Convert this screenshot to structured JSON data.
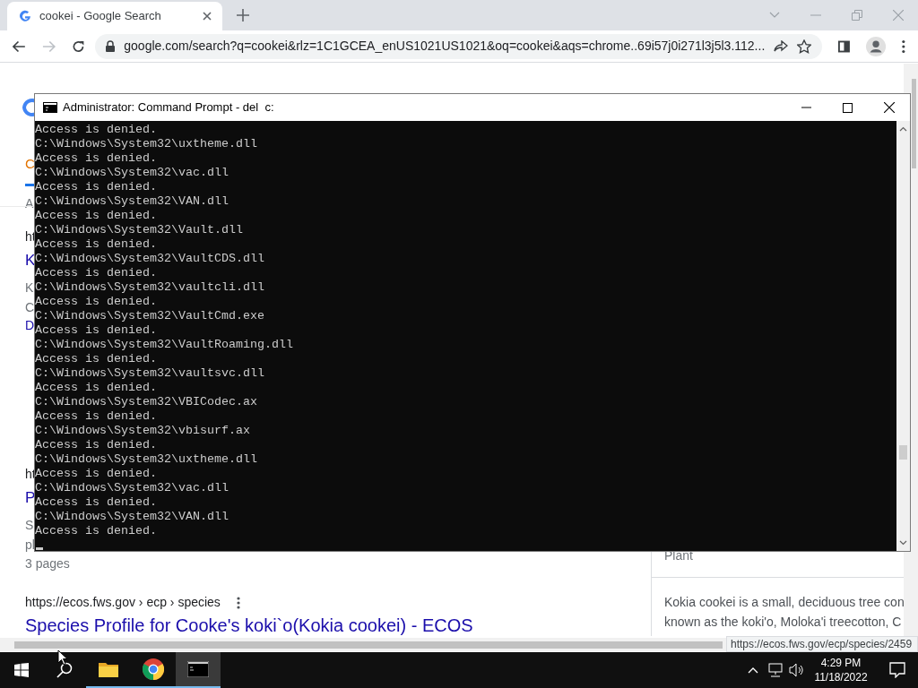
{
  "browser": {
    "tab": {
      "title": "cookei - Google Search",
      "selected": true
    },
    "url": "google.com/search?q=cookei&rlz=1C1GCEA_enUS1021US1021&oq=cookei&aqs=chrome..69i57j0i271l3j5l3.112...",
    "page": {
      "fragments": [
        {
          "kind": "tab",
          "text": "C"
        },
        {
          "kind": "meta",
          "text": "A"
        },
        {
          "kind": "url",
          "text": "ht"
        },
        {
          "kind": "title",
          "text": "K"
        },
        {
          "kind": "meta",
          "text": "K"
        },
        {
          "kind": "meta",
          "text": "C"
        },
        {
          "kind": "link",
          "text": "D"
        },
        {
          "kind": "url",
          "text": "ht"
        },
        {
          "kind": "title",
          "text": "P"
        },
        {
          "kind": "meta",
          "text": "S"
        },
        {
          "kind": "meta",
          "text": "pl"
        },
        {
          "kind": "meta",
          "text": "3 pages"
        }
      ],
      "result": {
        "breadcrumb": "https://ecos.fws.gov › ecp › species",
        "title": "Species Profile for Cooke's koki`o(Kokia cookei) - ECOS"
      },
      "panel": {
        "label": "Plant",
        "description": [
          "Kokia cookei is a small, deciduous tree con",
          "known as the koki'o, Moloka'i treecotton, C"
        ]
      },
      "status_url": "https://ecos.fws.gov/ecp/species/2459"
    }
  },
  "console": {
    "title": "Administrator: Command Prompt - del  c:",
    "lines": [
      "Access is denied.",
      "C:\\Windows\\System32\\uxtheme.dll",
      "Access is denied.",
      "C:\\Windows\\System32\\vac.dll",
      "Access is denied.",
      "C:\\Windows\\System32\\VAN.dll",
      "Access is denied.",
      "C:\\Windows\\System32\\Vault.dll",
      "Access is denied.",
      "C:\\Windows\\System32\\VaultCDS.dll",
      "Access is denied.",
      "C:\\Windows\\System32\\vaultcli.dll",
      "Access is denied.",
      "C:\\Windows\\System32\\VaultCmd.exe",
      "Access is denied.",
      "C:\\Windows\\System32\\VaultRoaming.dll",
      "Access is denied.",
      "C:\\Windows\\System32\\vaultsvc.dll",
      "Access is denied.",
      "C:\\Windows\\System32\\VBICodec.ax",
      "Access is denied.",
      "C:\\Windows\\System32\\vbisurf.ax",
      "Access is denied.",
      "C:\\Windows\\System32\\uxtheme.dll",
      "Access is denied.",
      "C:\\Windows\\System32\\vac.dll",
      "Access is denied.",
      "C:\\Windows\\System32\\VAN.dll",
      "Access is denied."
    ]
  },
  "taskbar": {
    "apps": [
      {
        "kind": "explorer",
        "selected": false
      },
      {
        "kind": "chrome",
        "selected": false
      },
      {
        "kind": "console",
        "selected": true
      }
    ],
    "time": "4:29 PM",
    "date": "11/18/2022"
  }
}
